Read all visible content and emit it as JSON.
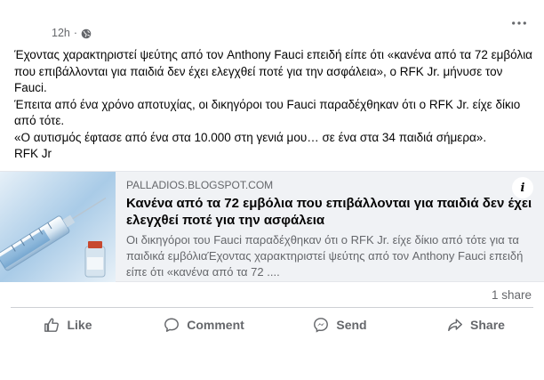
{
  "post": {
    "timestamp": "12h",
    "separator": "·",
    "paragraphs": [
      "Έχοντας χαρακτηριστεί ψεύτης από τον Anthony Fauci επειδή είπε ότι «κανένα από τα 72 εμβόλια που επιβάλλονται για παιδιά δεν έχει ελεγχθεί ποτέ για την ασφάλεια», ο RFK Jr. μήνυσε τον Fauci.",
      "Έπειτα από ένα χρόνο αποτυχίας, οι δικηγόροι του Fauci παραδέχθηκαν ότι ο RFK Jr. είχε δίκιο από τότε.",
      "«Ο αυτισμός έφτασε από ένα στα 10.000 στη γενιά μου… σε ένα στα 34 παιδιά σήμερα».",
      "RFK Jr"
    ]
  },
  "link": {
    "domain": "PALLADIOS.BLOGSPOT.COM",
    "title": "Κανένα από τα 72 εμβόλια που επιβάλλονται για παιδιά δεν έχει ελεγχθεί ποτέ για την ασφάλεια",
    "description": "Οι δικηγόροι του Fauci παραδέχθηκαν ότι ο RFK Jr. είχε δίκιο από τότε για τα παιδικά εμβόλιαΈχοντας χαρακτηριστεί ψεύτης από τον Anthony Fauci επειδή είπε ότι «κανένα από τα 72 ....",
    "info_icon": "i"
  },
  "stats": {
    "shares": "1 share"
  },
  "actions": [
    {
      "label": "Like",
      "icon": "thumbs-up-icon"
    },
    {
      "label": "Comment",
      "icon": "speech-bubble-icon"
    },
    {
      "label": "Send",
      "icon": "messenger-icon"
    },
    {
      "label": "Share",
      "icon": "share-arrow-icon"
    }
  ],
  "colors": {
    "text_primary": "#050505",
    "text_secondary": "#65676b",
    "card_background": "#f0f2f5"
  }
}
